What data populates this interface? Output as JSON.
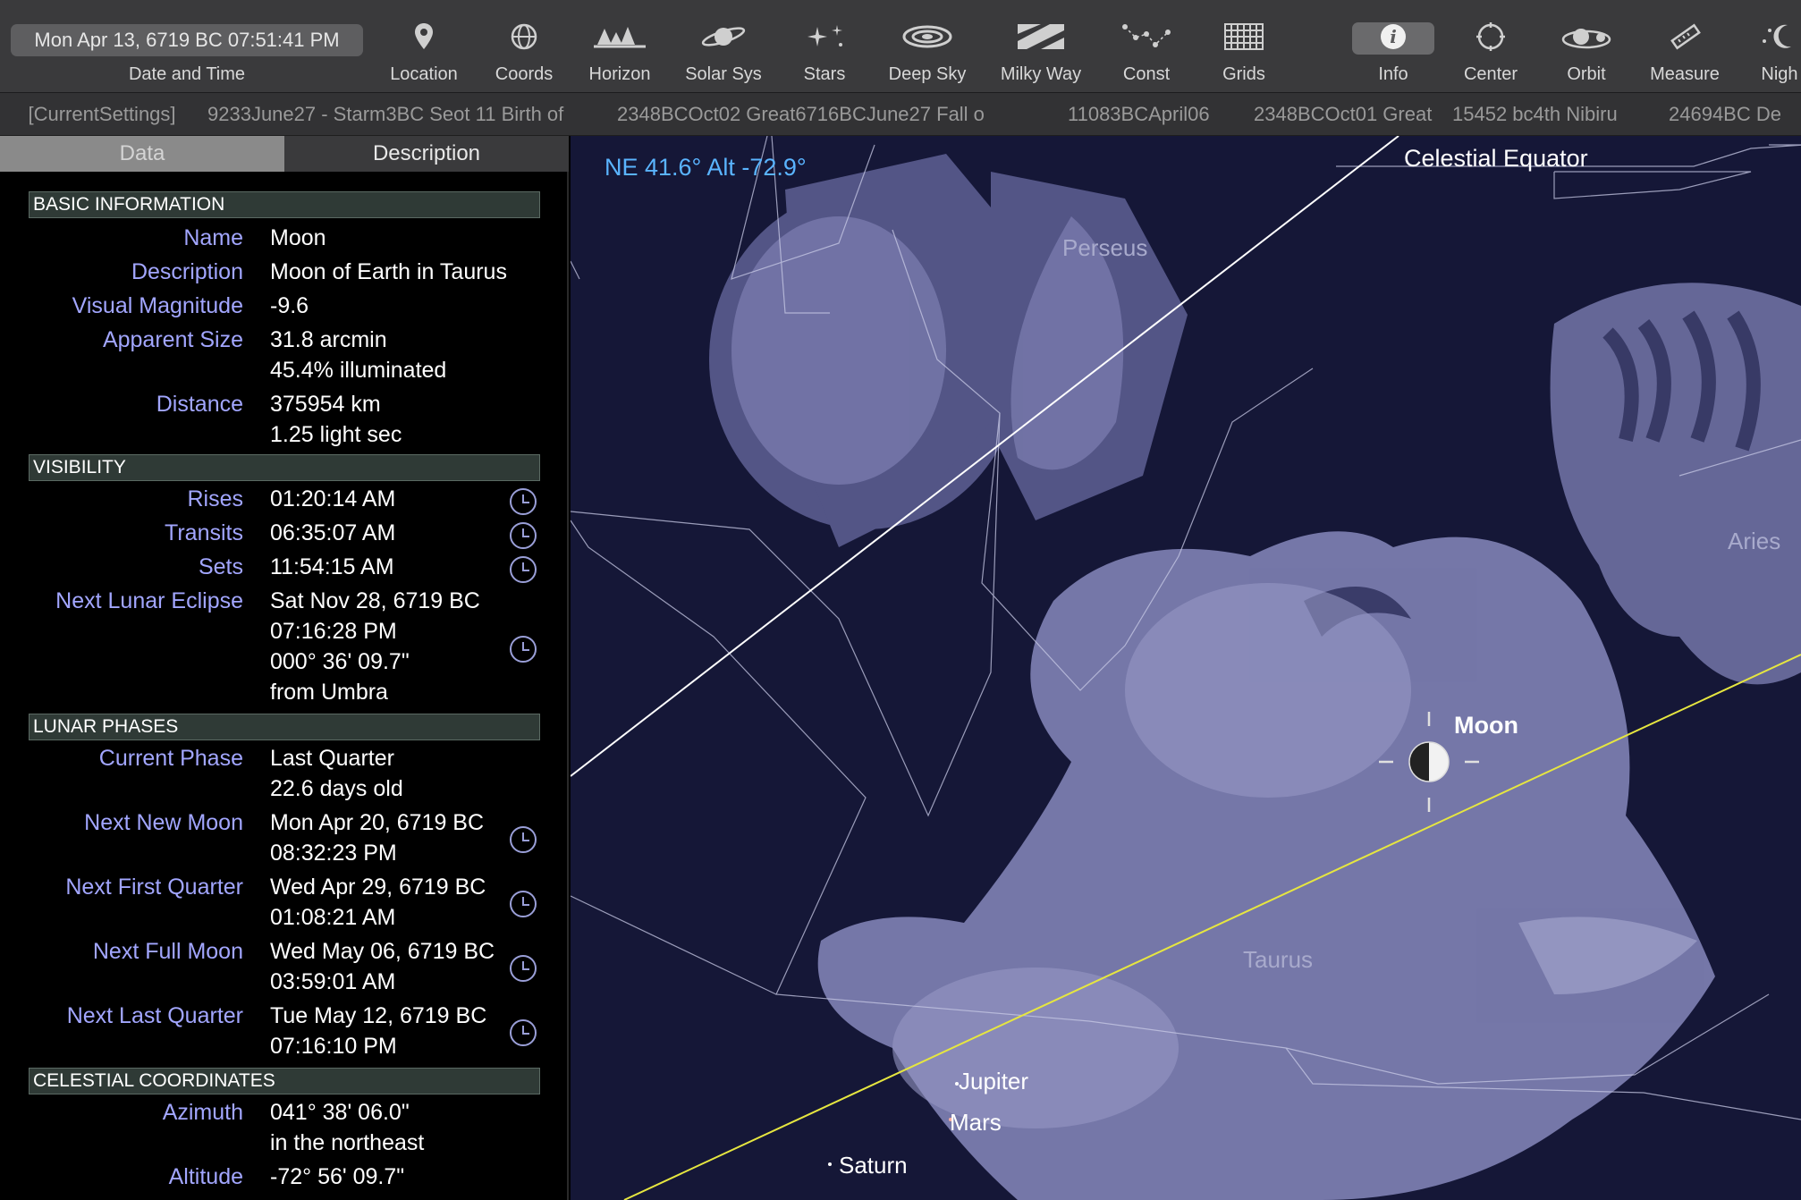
{
  "toolbar": {
    "datetime": "Mon Apr 13, 6719 BC 07:51:41 PM",
    "datetime_label": "Date and Time",
    "tools": [
      {
        "label": "Location",
        "icon": "location-pin-icon"
      },
      {
        "label": "Coords",
        "icon": "coords-icon"
      },
      {
        "label": "Horizon",
        "icon": "horizon-icon"
      },
      {
        "label": "Solar Sys",
        "icon": "planet-icon"
      },
      {
        "label": "Stars",
        "icon": "stars-icon"
      },
      {
        "label": "Deep Sky",
        "icon": "galaxy-icon"
      },
      {
        "label": "Milky Way",
        "icon": "milky-way-icon"
      },
      {
        "label": "Const",
        "icon": "constellation-icon"
      },
      {
        "label": "Grids",
        "icon": "grid-icon"
      },
      {
        "label": "Info",
        "icon": "info-icon"
      },
      {
        "label": "Center",
        "icon": "center-icon"
      },
      {
        "label": "Orbit",
        "icon": "orbit-icon"
      },
      {
        "label": "Measure",
        "icon": "ruler-icon"
      },
      {
        "label": "Nigh",
        "icon": "night-icon"
      }
    ]
  },
  "settings_strip": {
    "current": "[CurrentSettings]",
    "items": [
      "9233June27 - Starm3BC Seot 11 Birth of",
      "2348BCOct02 Great6716BCJune27 Fall o",
      "11083BCApril06",
      "2348BCOct01 Great",
      "15452 bc4th Nibiru",
      "24694BC De"
    ]
  },
  "tabs": {
    "data": "Data",
    "description": "Description"
  },
  "sections": {
    "basic": "BASIC INFORMATION",
    "visibility": "VISIBILITY",
    "lunar": "LUNAR PHASES",
    "celestial": "CELESTIAL COORDINATES"
  },
  "basic": {
    "name_label": "Name",
    "name": "Moon",
    "description_label": "Description",
    "description": "Moon of Earth in Taurus",
    "magnitude_label": "Visual Magnitude",
    "magnitude": "-9.6",
    "size_label": "Apparent Size",
    "size": "31.8 arcmin",
    "illuminated": "45.4% illuminated",
    "distance_label": "Distance",
    "distance_km": "375954 km",
    "distance_ls": "1.25 light sec"
  },
  "visibility": {
    "rises_label": "Rises",
    "rises": "01:20:14 AM",
    "transits_label": "Transits",
    "transits": "06:35:07 AM",
    "sets_label": "Sets",
    "sets": "11:54:15 AM",
    "eclipse_label": "Next Lunar Eclipse",
    "eclipse_date": "Sat Nov 28, 6719 BC",
    "eclipse_time": "07:16:28 PM",
    "eclipse_sep": "000° 36' 09.7\"",
    "eclipse_from": "from Umbra"
  },
  "lunar": {
    "current_label": "Current Phase",
    "current": "Last Quarter",
    "age": "22.6 days old",
    "new_label": "Next New Moon",
    "new_date": "Mon Apr 20, 6719 BC",
    "new_time": "08:32:23 PM",
    "first_label": "Next First Quarter",
    "first_date": "Wed Apr 29, 6719 BC",
    "first_time": "01:08:21 AM",
    "full_label": "Next Full Moon",
    "full_date": "Wed May 06, 6719 BC",
    "full_time": "03:59:01 AM",
    "last_label": "Next Last Quarter",
    "last_date": "Tue May 12, 6719 BC",
    "last_time": "07:16:10 PM"
  },
  "celestial": {
    "azimuth_label": "Azimuth",
    "azimuth": "041° 38' 06.0\"",
    "azimuth_dir": "in the northeast",
    "altitude_label": "Altitude",
    "altitude": "-72° 56' 09.7\""
  },
  "sky": {
    "readout": "NE 41.6° Alt -72.9°",
    "equator_label": "Celestial Equator",
    "constellations": [
      "Perseus",
      "Aries",
      "Taurus"
    ],
    "moon_label": "Moon",
    "planets": [
      "Jupiter",
      "Mars",
      "Saturn"
    ],
    "colors": {
      "background": "#151737",
      "readout": "#5ab4ff",
      "ecliptic": "#e6e640",
      "equator": "#ffffff",
      "figure": "#8e90b8"
    }
  }
}
